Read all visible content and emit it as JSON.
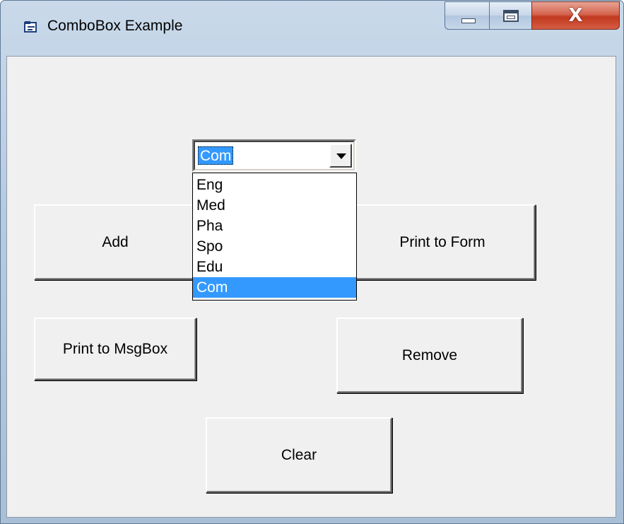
{
  "window": {
    "title": "ComboBox Example",
    "close_glyph": "X",
    "icons": [
      "app-icon",
      "minimize-icon",
      "maximize-icon",
      "close-icon"
    ]
  },
  "combo": {
    "value": "Com",
    "icon": "chevron-down-icon",
    "options": [
      "Eng",
      "Med",
      "Pha",
      "Spo",
      "Edu",
      "Com"
    ],
    "selected_option": "Com"
  },
  "buttons": {
    "add": "Add",
    "print_form": "Print to Form",
    "print_msgbox": "Print to MsgBox",
    "remove": "Remove",
    "clear": "Clear"
  },
  "colors": {
    "selection": "#3399ff",
    "client_bg": "#f0f0f0",
    "close_button": "#c1391f"
  }
}
